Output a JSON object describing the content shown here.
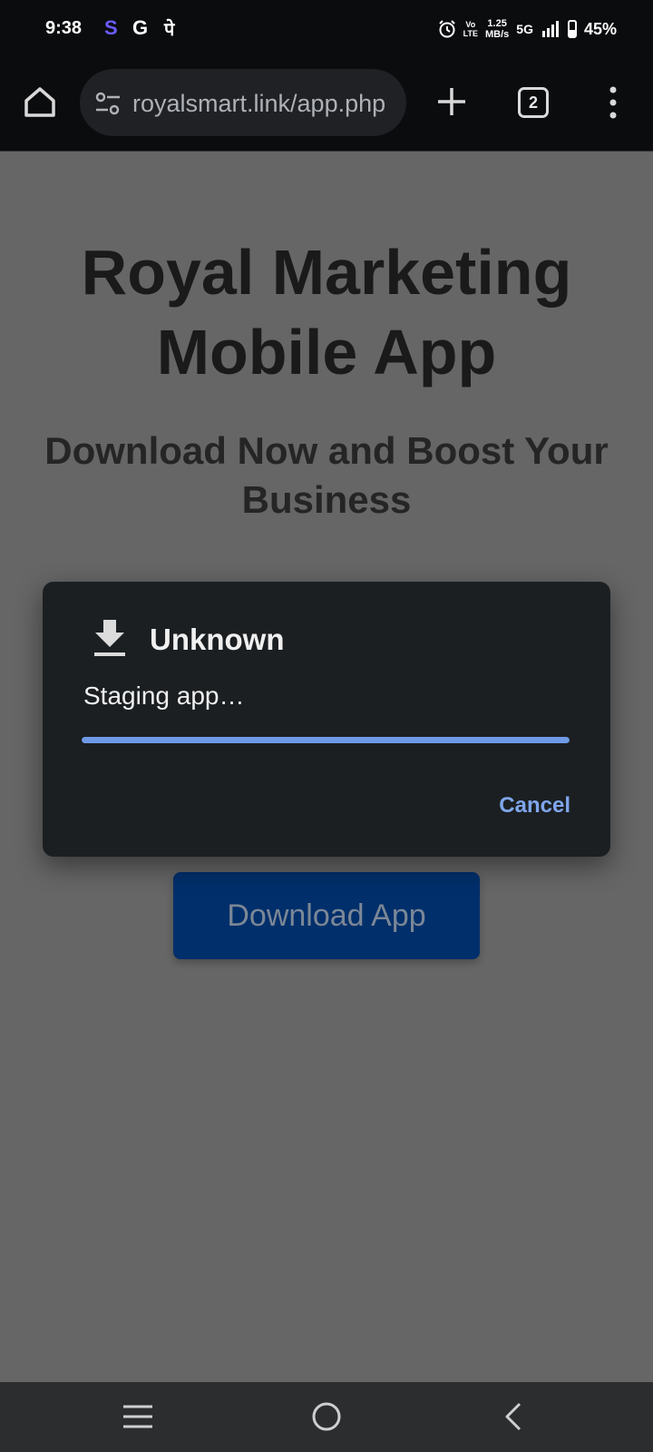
{
  "status_bar": {
    "time": "9:38",
    "app_icons": [
      "S",
      "G",
      "पे"
    ],
    "volte_top": "Vo",
    "volte_bottom": "LTE",
    "speed_value": "1.25",
    "speed_unit": "MB/s",
    "network": "5G",
    "battery_percent_label": "45%",
    "battery_level": 0.45
  },
  "browser": {
    "url": "royalsmart.link/app.php",
    "tab_count": "2"
  },
  "page": {
    "title": "Royal Marketing Mobile App",
    "subtitle": "Download Now and Boost Your Business",
    "download_button": "Download App"
  },
  "dialog": {
    "title": "Unknown",
    "status": "Staging app…",
    "progress": 1.0,
    "cancel_label": "Cancel"
  },
  "colors": {
    "accent": "#6f9ae6",
    "cancel": "#7fa6ec",
    "button": "#002f6b"
  }
}
